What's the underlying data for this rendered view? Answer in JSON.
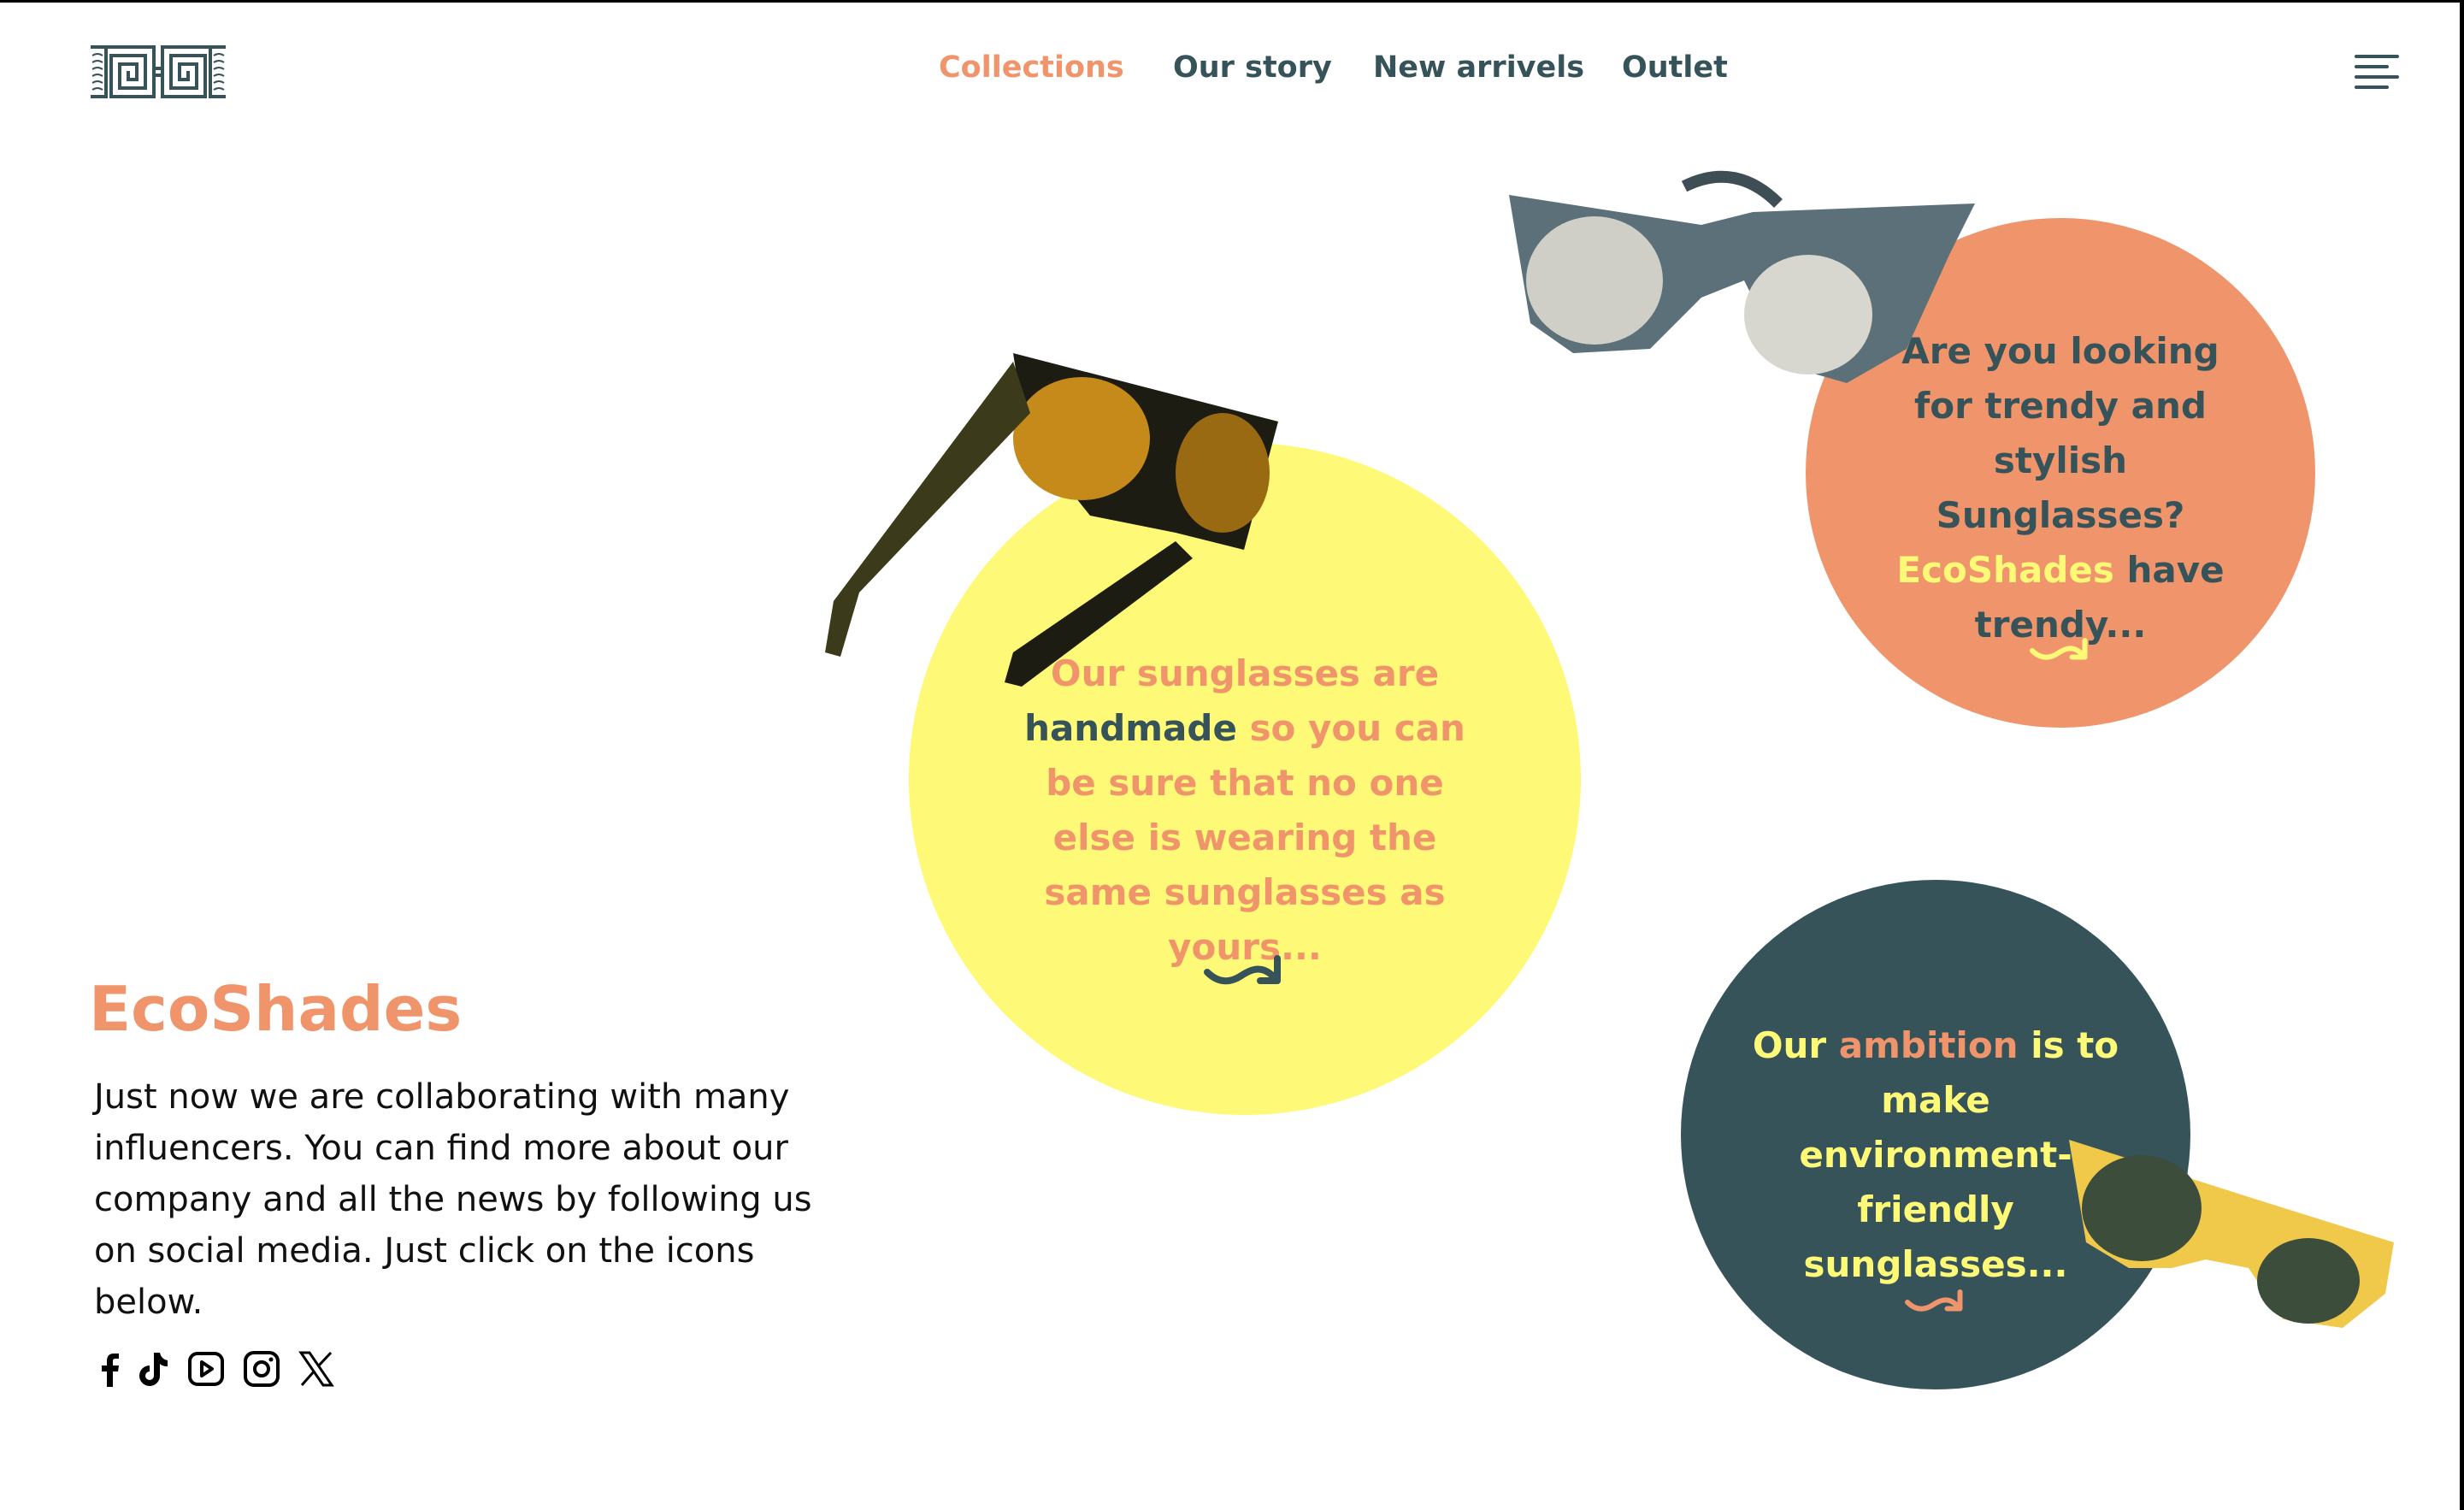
{
  "nav": {
    "items": [
      {
        "label": "Collections",
        "active": true
      },
      {
        "label": "Our story"
      },
      {
        "label": "New arrivels"
      },
      {
        "label": "Outlet"
      }
    ]
  },
  "colors": {
    "accent": "#F0956B",
    "dark": "#36535A",
    "yellow": "#FEF977"
  },
  "cards": {
    "handmade": {
      "pre": "Our sunglasses are",
      "bold": "handmade",
      "post": "so you can be sure that no one else is wearing the same sunglasses as yours..."
    },
    "trendy": {
      "pre": "Are you looking for trendy and stylish Sunglasses?",
      "brand": "EcoShades",
      "post": "have trendy..."
    },
    "ambition": {
      "pre": "Our",
      "highlight": "ambition",
      "post": "is to make environment-friendly sunglasses..."
    }
  },
  "about": {
    "brand": "EcoShades",
    "text": "Just now we are collaborating with many influencers. You can find more about our company and all the news by following us on social media. Just click on the icons below."
  },
  "social": [
    "facebook-icon",
    "tiktok-icon",
    "youtube-icon",
    "instagram-icon",
    "x-icon"
  ]
}
